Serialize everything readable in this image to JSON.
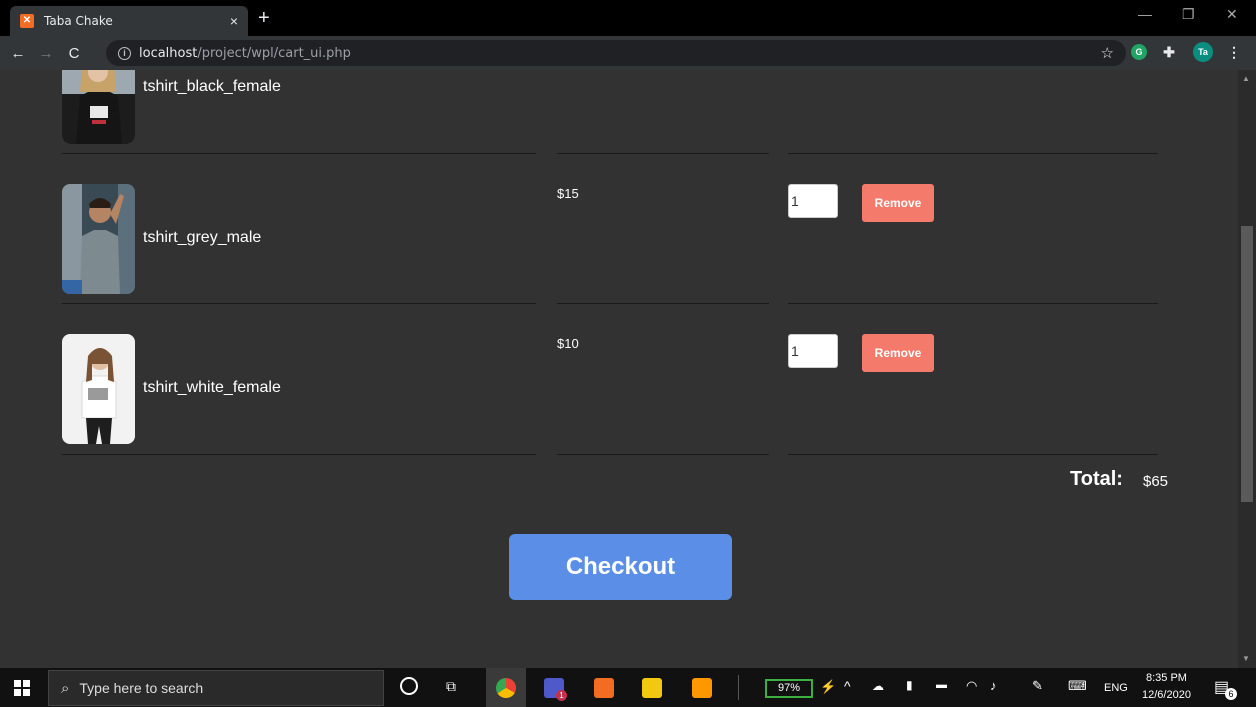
{
  "browser": {
    "tab_title": "Taba Chake",
    "tab_close": "×",
    "new_tab": "+",
    "url_host": "localhost",
    "url_path": "/project/wpl/cart_ui.php",
    "profile_initials": "Ta",
    "ext_g": "G"
  },
  "cart": {
    "items": [
      {
        "name": "tshirt_black_female",
        "price": "",
        "qty": ""
      },
      {
        "name": "tshirt_grey_male",
        "price": "$15",
        "qty": "1"
      },
      {
        "name": "tshirt_white_female",
        "price": "$10",
        "qty": "1"
      }
    ],
    "remove_label": "Remove",
    "total_label": "Total:",
    "total_value": "$65",
    "checkout_label": "Checkout"
  },
  "taskbar": {
    "search_placeholder": "Type here to search",
    "battery": "97%",
    "lang": "ENG",
    "time": "8:35 PM",
    "date": "12/6/2020",
    "notifications": "6",
    "teams_badge": "1"
  },
  "colors": {
    "page_bg": "#323232",
    "remove_button": "#f47a6b",
    "checkout_button": "#5b8ee6"
  }
}
